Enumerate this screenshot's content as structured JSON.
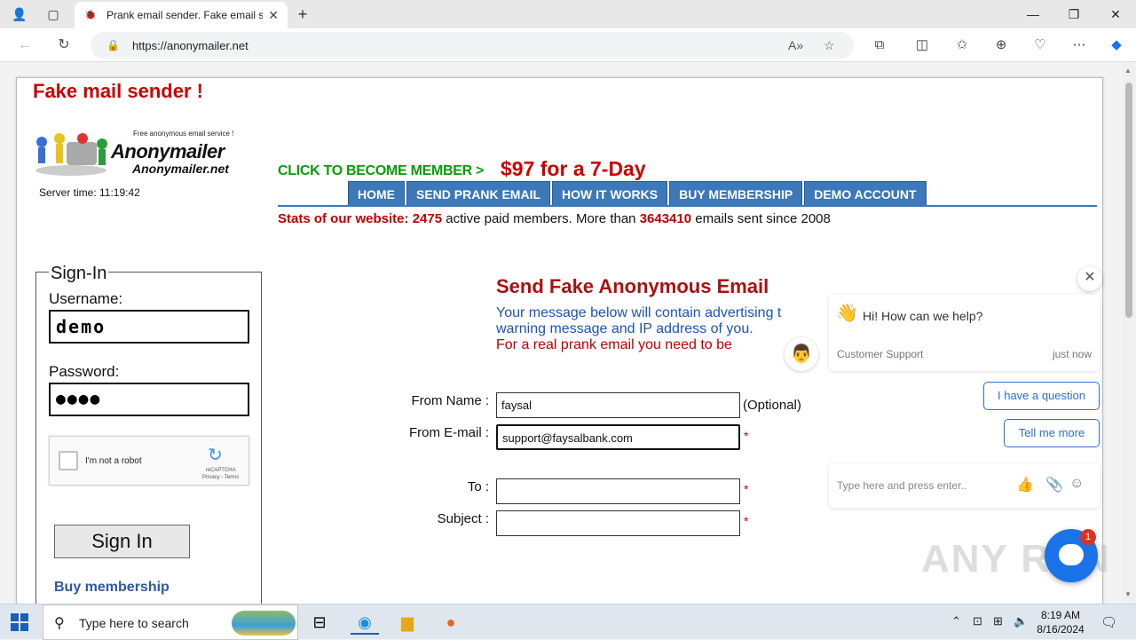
{
  "browser": {
    "tab_title": "Prank email sender. Fake email se",
    "tab_favicon": "🐞",
    "url": "https://anonymailer.net",
    "read_aloud": "A»"
  },
  "site": {
    "title": "Fake mail sender !",
    "logo_tagline": "Free anonymous email service !",
    "logo_name": "Anonymailer",
    "logo_domain": "Anonymailer.net",
    "server_time_label": "Server time: 11:19:42",
    "member_cta": "CLICK TO BECOME MEMBER >",
    "member_price": "$97 for a 7-Day",
    "nav": [
      "HOME",
      "SEND PRANK EMAIL",
      "HOW IT WORKS",
      "BUY MEMBERSHIP",
      "DEMO ACCOUNT"
    ],
    "stats": {
      "prefix": "Stats of our website:",
      "members": "2475",
      "mid": " active paid members. More than ",
      "emails": "3643410",
      "suffix": "  emails sent since 2008"
    }
  },
  "signin": {
    "legend": "Sign-In",
    "username_label": "Username:",
    "username_value": "demo",
    "password_label": "Password:",
    "password_value": "●●●●",
    "captcha_text": "I'm not a robot",
    "captcha_brand": "reCAPTCHA",
    "captcha_terms": "Privacy - Terms",
    "button": "Sign In",
    "buy_link": "Buy membership"
  },
  "form": {
    "title": "Send Fake Anonymous Email",
    "notice_blue": "Your message below will contain advertising t warning message and IP address of you.",
    "notice_red": "For a real prank email you need to be",
    "from_name_label": "From Name :",
    "from_name_value": "faysal",
    "optional": "(Optional)",
    "from_email_label": "From E-mail :",
    "from_email_value": "support@faysalbank.com",
    "to_label": "To :",
    "to_value": "",
    "subject_label": "Subject :",
    "subject_value": "",
    "required_mark": "*"
  },
  "chat": {
    "greeting": "Hi! How can we help?",
    "agent": "Customer Support",
    "time": "just now",
    "btn_question": "I have a question",
    "btn_tell": "Tell me more",
    "input_placeholder": "Type here and press enter..",
    "badge": "1"
  },
  "watermark": "ANY RUN",
  "taskbar": {
    "search_placeholder": "Type here to search",
    "time": "8:19 AM",
    "date": "8/16/2024"
  }
}
